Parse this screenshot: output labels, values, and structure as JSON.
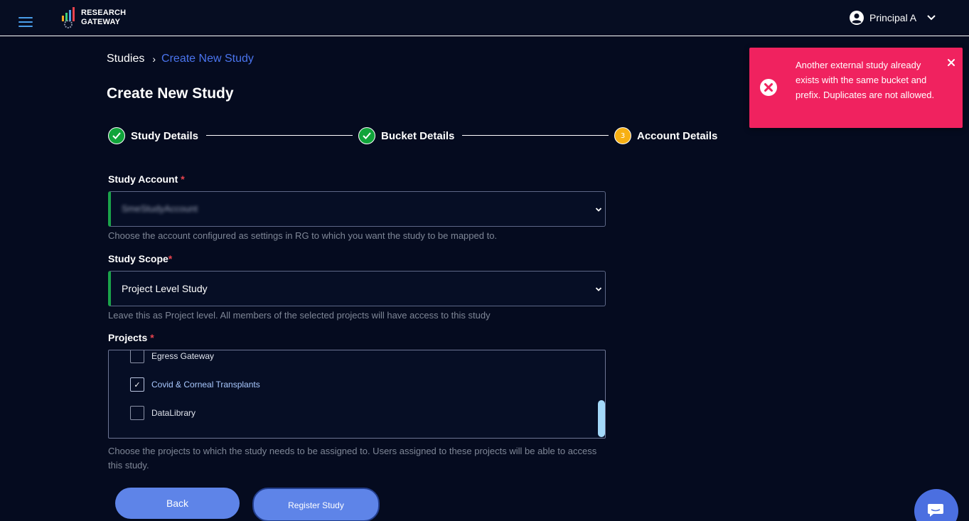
{
  "header": {
    "brand_line1": "RESEARCH",
    "brand_line2": "GATEWAY",
    "user_name": "Principal A",
    "icons": {
      "menu": "hamburger-icon",
      "user": "user-circle-icon",
      "dropdown": "chevron-down-icon"
    }
  },
  "breadcrumb": {
    "root": "Studies",
    "current": "Create New Study"
  },
  "page_title": "Create New Study",
  "stepper": {
    "steps": [
      {
        "label": "Study Details",
        "state": "complete"
      },
      {
        "label": "Bucket Details",
        "state": "complete"
      },
      {
        "label": "Account Details",
        "state": "active",
        "number": "3"
      }
    ]
  },
  "form": {
    "study_account": {
      "label": "Study Account",
      "required": "*",
      "value": "SmeStudyAccount",
      "help": "Choose the account configured as settings in RG to which you want the study to be mapped to."
    },
    "study_scope": {
      "label": "Study Scope",
      "required": "*",
      "value": "Project Level Study",
      "help": "Leave this as Project level. All members of the selected projects will have access to this study"
    },
    "projects": {
      "label": "Projects",
      "required": "*",
      "items": [
        {
          "label": "Egress Gateway",
          "checked": false
        },
        {
          "label": "Covid & Corneal Transplants",
          "checked": true
        },
        {
          "label": "DataLibrary",
          "checked": false
        }
      ],
      "help": "Choose the projects to which the study needs to be assigned to. Users assigned to these projects will be able to access this study."
    }
  },
  "buttons": {
    "back": "Back",
    "register": "Register Study"
  },
  "toast": {
    "message": "Another external study already exists with the same bucket and prefix. Duplicates are not allowed.",
    "color": "#f0225f"
  },
  "colors": {
    "background": "#050b1f",
    "accent": "#5e84e8",
    "success": "#10a43a",
    "warning": "#f7b013"
  }
}
